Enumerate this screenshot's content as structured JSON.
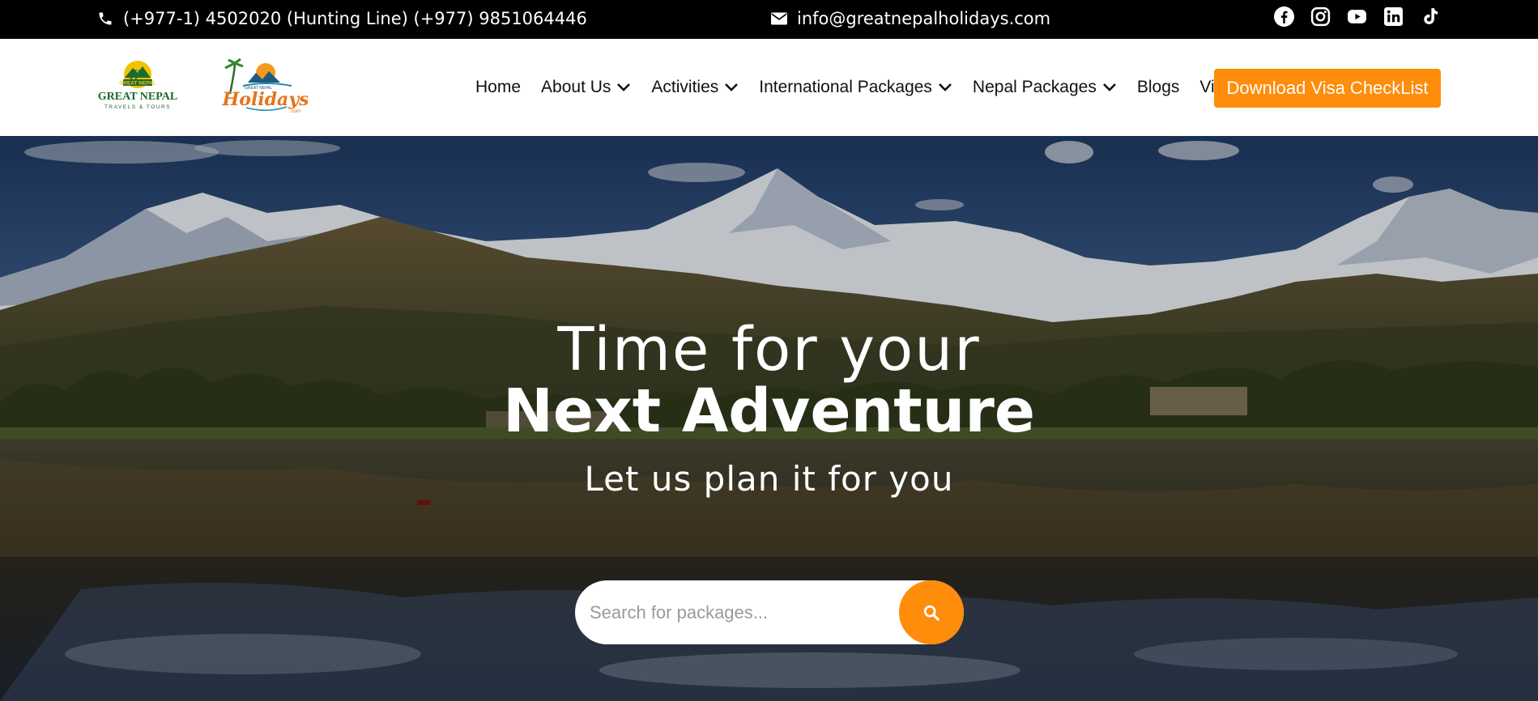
{
  "topbar": {
    "phone": "(+977-1) 4502020 (Hunting Line) (+977) 9851064446",
    "email": "info@greatnepalholidays.com",
    "socials": [
      "facebook-icon",
      "instagram-icon",
      "youtube-icon",
      "linkedin-icon",
      "tiktok-icon"
    ]
  },
  "header": {
    "logo1": {
      "brand": "GREAT NEPAL",
      "tagline": "TRAVELS & TOURS",
      "badge": "GREAT NEPAL"
    },
    "logo2": {
      "top": "GREAT NEPAL",
      "brand": "Holidays",
      "suffix": ".com"
    },
    "nav": [
      {
        "label": "Home"
      },
      {
        "label": "About Us"
      },
      {
        "label": "Activities"
      },
      {
        "label": "International Packages"
      },
      {
        "label": "Nepal Packages"
      },
      {
        "label": "Blogs"
      },
      {
        "label": "Visa"
      }
    ],
    "cta_label": "Download Visa CheckList"
  },
  "hero": {
    "line1": "Time for your",
    "line2": "Next Adventure",
    "line3": "Let us plan it for you",
    "search_placeholder": "Search for packages..."
  },
  "colors": {
    "accent": "#ff8c0a",
    "topbar": "#000000"
  }
}
